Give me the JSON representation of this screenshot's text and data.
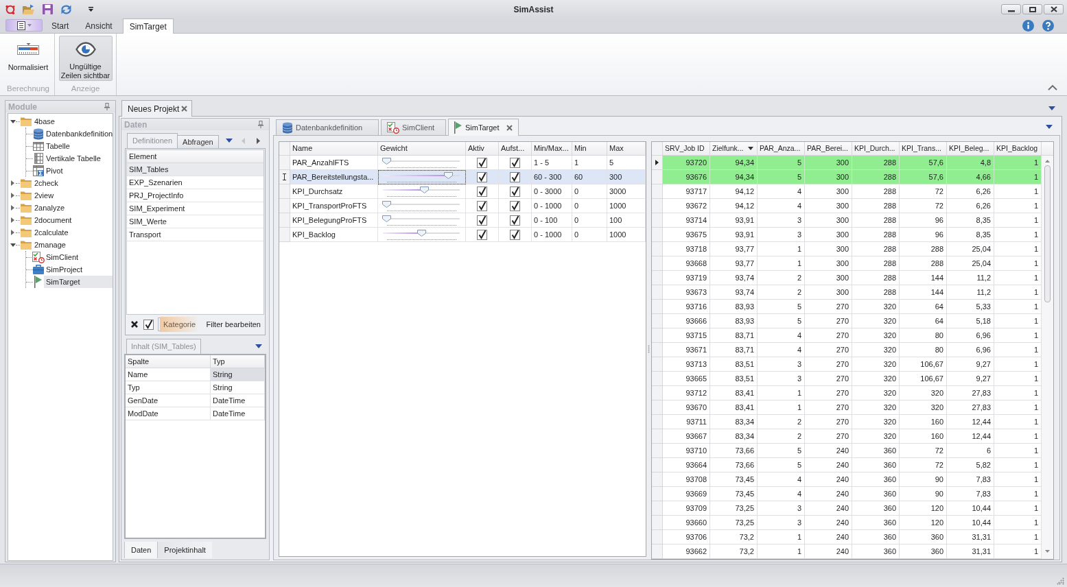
{
  "window": {
    "title": "SimAssist"
  },
  "ribbon": {
    "tabs": [
      {
        "label": "Start",
        "selected": false
      },
      {
        "label": "Ansicht",
        "selected": false
      },
      {
        "label": "SimTarget",
        "selected": true
      }
    ],
    "groups": [
      {
        "label": "Berechnung",
        "buttons": [
          {
            "label": "Normalisiert",
            "pressed": false
          }
        ]
      },
      {
        "label": "Anzeige",
        "buttons": [
          {
            "label": "Ungültige Zeilen sichtbar",
            "pressed": true
          }
        ]
      }
    ]
  },
  "modules_panel": {
    "title": "Module",
    "tree": [
      {
        "label": "4base",
        "kind": "folder",
        "expanded": true,
        "selected": false,
        "children": [
          {
            "label": "Datenbankdefinition",
            "kind": "database",
            "selected": false
          },
          {
            "label": "Tabelle",
            "kind": "table",
            "selected": false
          },
          {
            "label": "Vertikale Tabelle",
            "kind": "vertical",
            "selected": false
          },
          {
            "label": "Pivot",
            "kind": "pivot",
            "selected": false
          }
        ]
      },
      {
        "label": "2check",
        "kind": "folder",
        "expanded": false,
        "selected": false
      },
      {
        "label": "2view",
        "kind": "folder",
        "expanded": false,
        "selected": false
      },
      {
        "label": "2analyze",
        "kind": "folder",
        "expanded": false,
        "selected": false
      },
      {
        "label": "2document",
        "kind": "folder",
        "expanded": false,
        "selected": false
      },
      {
        "label": "2calculate",
        "kind": "folder",
        "expanded": false,
        "selected": false
      },
      {
        "label": "2manage",
        "kind": "folder",
        "expanded": true,
        "selected": false,
        "children": [
          {
            "label": "SimClient",
            "kind": "client",
            "selected": false
          },
          {
            "label": "SimProject",
            "kind": "project",
            "selected": false
          },
          {
            "label": "SimTarget",
            "kind": "target",
            "selected": true
          }
        ]
      }
    ]
  },
  "document_tabs": [
    {
      "label": "Neues Projekt",
      "selected": true
    }
  ],
  "data_panel": {
    "title": "Daten",
    "tabs": [
      {
        "label": "Definitionen",
        "selected": true
      },
      {
        "label": "Abfragen",
        "selected": false
      }
    ],
    "tab_nav": {
      "previous_disabled": true,
      "next_disabled": false
    },
    "element_list": {
      "header": "Element",
      "items": [
        {
          "label": "SIM_Tables",
          "selected": true
        },
        {
          "label": "EXP_Szenarien",
          "selected": false
        },
        {
          "label": "PRJ_ProjectInfo",
          "selected": false
        },
        {
          "label": "SIM_Experiment",
          "selected": false
        },
        {
          "label": "SIM_Werte",
          "selected": false
        },
        {
          "label": "Transport",
          "selected": false
        }
      ]
    },
    "filter_bar": {
      "checked": true,
      "category": "Kategorie",
      "edit_link": "Filter bearbeiten"
    },
    "content_tab": "Inhalt (SIM_Tables)",
    "content_table": {
      "columns": [
        "Spalte",
        "Typ"
      ],
      "rows": [
        {
          "cells": [
            "Name",
            "String"
          ],
          "selected": true
        },
        {
          "cells": [
            "Typ",
            "String"
          ],
          "selected": false
        },
        {
          "cells": [
            "GenDate",
            "DateTime"
          ],
          "selected": false
        },
        {
          "cells": [
            "ModDate",
            "DateTime"
          ],
          "selected": false
        }
      ]
    },
    "bottom_tabs": [
      {
        "label": "Daten",
        "selected": true
      },
      {
        "label": "Projektinhalt",
        "selected": false
      }
    ]
  },
  "editor_tabs": [
    {
      "label": "Datenbankdefinition",
      "kind": "database",
      "selected": false
    },
    {
      "label": "SimClient",
      "kind": "client",
      "selected": false
    },
    {
      "label": "SimTarget",
      "kind": "target",
      "selected": true
    }
  ],
  "targets_grid": {
    "columns": [
      "Name",
      "Gewicht",
      "Aktiv",
      "Aufst...",
      "Min/Max...",
      "Min",
      "Max"
    ],
    "rows": [
      {
        "name": "PAR_AnzahlFTS",
        "level": 0,
        "aktiv": true,
        "aufst": true,
        "min_max": "1 - 5",
        "min": "1",
        "max": "5",
        "selected": false
      },
      {
        "name": "PAR_Bereitstellungsta...",
        "level": 0.89,
        "aktiv": true,
        "aufst": true,
        "min_max": "60 - 300",
        "min": "60",
        "max": "300",
        "selected": true
      },
      {
        "name": "KPI_Durchsatz",
        "level": 0.54,
        "aktiv": true,
        "aufst": true,
        "min_max": "0 - 3000",
        "min": "0",
        "max": "3000",
        "selected": false
      },
      {
        "name": "KPI_TransportProFTS",
        "level": 0,
        "aktiv": true,
        "aufst": true,
        "min_max": "0 - 1000",
        "min": "0",
        "max": "1000",
        "selected": false
      },
      {
        "name": "KPI_BelegungProFTS",
        "level": 0,
        "aktiv": true,
        "aufst": true,
        "min_max": "0 - 100",
        "min": "0",
        "max": "100",
        "selected": false
      },
      {
        "name": "KPI_Backlog",
        "level": 0.5,
        "aktiv": true,
        "aufst": true,
        "min_max": "0 - 1000",
        "min": "0",
        "max": "1000",
        "selected": false
      }
    ]
  },
  "results_grid": {
    "columns": [
      {
        "label": "SRV_Job ID",
        "sorted": false
      },
      {
        "label": "Zielfunk...",
        "sorted": true
      },
      {
        "label": "PAR_Anza...",
        "sorted": false
      },
      {
        "label": "PAR_Berei...",
        "sorted": false
      },
      {
        "label": "KPI_Durch...",
        "sorted": false
      },
      {
        "label": "KPI_Trans...",
        "sorted": false
      },
      {
        "label": "KPI_Beleg...",
        "sorted": false
      },
      {
        "label": "KPI_Backlog",
        "sorted": false
      }
    ],
    "rows": [
      {
        "cells": [
          "93720",
          "94,34",
          "5",
          "300",
          "288",
          "57,6",
          "4,8",
          "1"
        ],
        "highlighted": true,
        "current": true
      },
      {
        "cells": [
          "93676",
          "94,34",
          "5",
          "300",
          "288",
          "57,6",
          "4,66",
          "1"
        ],
        "highlighted": true,
        "current": false
      },
      {
        "cells": [
          "93717",
          "94,12",
          "4",
          "300",
          "288",
          "72",
          "6,26",
          "1"
        ],
        "highlighted": false,
        "current": false
      },
      {
        "cells": [
          "93672",
          "94,12",
          "4",
          "300",
          "288",
          "72",
          "6,26",
          "1"
        ],
        "highlighted": false,
        "current": false
      },
      {
        "cells": [
          "93714",
          "93,91",
          "3",
          "300",
          "288",
          "96",
          "8,35",
          "1"
        ],
        "highlighted": false,
        "current": false
      },
      {
        "cells": [
          "93675",
          "93,91",
          "3",
          "300",
          "288",
          "96",
          "8,35",
          "1"
        ],
        "highlighted": false,
        "current": false
      },
      {
        "cells": [
          "93718",
          "93,77",
          "1",
          "300",
          "288",
          "288",
          "25,04",
          "1"
        ],
        "highlighted": false,
        "current": false
      },
      {
        "cells": [
          "93668",
          "93,77",
          "1",
          "300",
          "288",
          "288",
          "25,04",
          "1"
        ],
        "highlighted": false,
        "current": false
      },
      {
        "cells": [
          "93719",
          "93,74",
          "2",
          "300",
          "288",
          "144",
          "11,2",
          "1"
        ],
        "highlighted": false,
        "current": false
      },
      {
        "cells": [
          "93673",
          "93,74",
          "2",
          "300",
          "288",
          "144",
          "11,2",
          "1"
        ],
        "highlighted": false,
        "current": false
      },
      {
        "cells": [
          "93716",
          "83,93",
          "5",
          "270",
          "320",
          "64",
          "5,33",
          "1"
        ],
        "highlighted": false,
        "current": false
      },
      {
        "cells": [
          "93666",
          "83,93",
          "5",
          "270",
          "320",
          "64",
          "5,18",
          "1"
        ],
        "highlighted": false,
        "current": false
      },
      {
        "cells": [
          "93715",
          "83,71",
          "4",
          "270",
          "320",
          "80",
          "6,96",
          "1"
        ],
        "highlighted": false,
        "current": false
      },
      {
        "cells": [
          "93671",
          "83,71",
          "4",
          "270",
          "320",
          "80",
          "6,96",
          "1"
        ],
        "highlighted": false,
        "current": false
      },
      {
        "cells": [
          "93713",
          "83,51",
          "3",
          "270",
          "320",
          "106,67",
          "9,27",
          "1"
        ],
        "highlighted": false,
        "current": false
      },
      {
        "cells": [
          "93665",
          "83,51",
          "3",
          "270",
          "320",
          "106,67",
          "9,27",
          "1"
        ],
        "highlighted": false,
        "current": false
      },
      {
        "cells": [
          "93712",
          "83,41",
          "1",
          "270",
          "320",
          "320",
          "27,83",
          "1"
        ],
        "highlighted": false,
        "current": false
      },
      {
        "cells": [
          "93670",
          "83,41",
          "1",
          "270",
          "320",
          "320",
          "27,83",
          "1"
        ],
        "highlighted": false,
        "current": false
      },
      {
        "cells": [
          "93711",
          "83,34",
          "2",
          "270",
          "320",
          "160",
          "12,44",
          "1"
        ],
        "highlighted": false,
        "current": false
      },
      {
        "cells": [
          "93667",
          "83,34",
          "2",
          "270",
          "320",
          "160",
          "12,44",
          "1"
        ],
        "highlighted": false,
        "current": false
      },
      {
        "cells": [
          "93710",
          "73,66",
          "5",
          "240",
          "360",
          "72",
          "6",
          "1"
        ],
        "highlighted": false,
        "current": false
      },
      {
        "cells": [
          "93664",
          "73,66",
          "5",
          "240",
          "360",
          "72",
          "5,82",
          "1"
        ],
        "highlighted": false,
        "current": false
      },
      {
        "cells": [
          "93708",
          "73,45",
          "4",
          "240",
          "360",
          "90",
          "7,83",
          "1"
        ],
        "highlighted": false,
        "current": false
      },
      {
        "cells": [
          "93669",
          "73,45",
          "4",
          "240",
          "360",
          "90",
          "7,83",
          "1"
        ],
        "highlighted": false,
        "current": false
      },
      {
        "cells": [
          "93709",
          "73,25",
          "3",
          "240",
          "360",
          "120",
          "10,44",
          "1"
        ],
        "highlighted": false,
        "current": false
      },
      {
        "cells": [
          "93660",
          "73,25",
          "3",
          "240",
          "360",
          "120",
          "10,44",
          "1"
        ],
        "highlighted": false,
        "current": false
      },
      {
        "cells": [
          "93706",
          "73,2",
          "1",
          "240",
          "360",
          "360",
          "31,31",
          "1"
        ],
        "highlighted": false,
        "current": false
      },
      {
        "cells": [
          "93662",
          "73,2",
          "1",
          "240",
          "360",
          "360",
          "31,31",
          "1"
        ],
        "highlighted": false,
        "current": false
      }
    ]
  }
}
